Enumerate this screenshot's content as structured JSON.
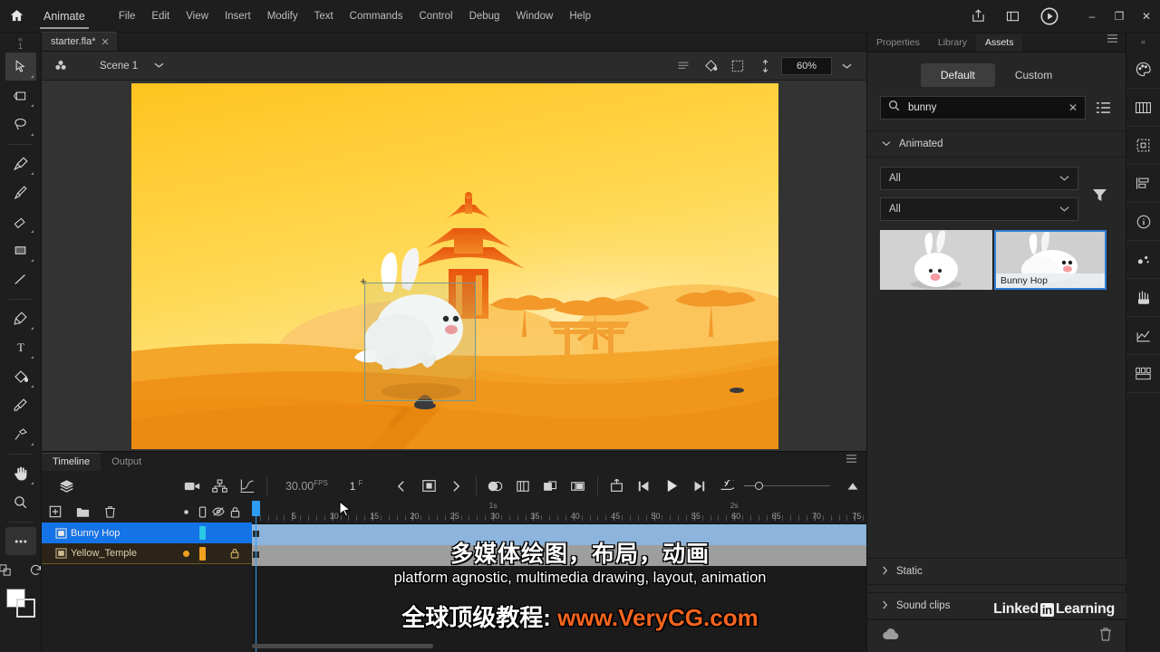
{
  "app": {
    "home_icon": "home-icon",
    "name": "Animate",
    "menus": [
      "File",
      "Edit",
      "View",
      "Insert",
      "Modify",
      "Text",
      "Commands",
      "Control",
      "Debug",
      "Window",
      "Help"
    ],
    "titlebar_buttons": [
      "share-icon",
      "workspace-icon",
      "test-movie-icon"
    ],
    "window_controls": {
      "minimize": "–",
      "maximize": "❐",
      "close": "✕"
    }
  },
  "document": {
    "tab_label": "starter.fla*",
    "tab_close": "✕"
  },
  "scenebar": {
    "symbol_icon": "scene-symbol-icon",
    "scene_name": "Scene 1",
    "caret": "chevron-down-icon",
    "right_icons": [
      "clip-content-icon",
      "fit-stage-icon",
      "rotate-icon"
    ],
    "zoom_value": "60%",
    "zoom_caret": "chevron-down-icon"
  },
  "tools": [
    {
      "name": "selection-tool",
      "glyph": "arrow",
      "active": true
    },
    {
      "name": "free-transform-tool",
      "glyph": "transform",
      "active": false
    },
    {
      "name": "lasso-tool",
      "glyph": "lasso",
      "active": false
    },
    {
      "name": "paint-brush-tool",
      "glyph": "paintbrush",
      "active": false
    },
    {
      "name": "brush-tool",
      "glyph": "brush",
      "active": false
    },
    {
      "name": "eraser-tool",
      "glyph": "eraser",
      "active": false
    },
    {
      "name": "rectangle-tool",
      "glyph": "rect",
      "active": false
    },
    {
      "name": "line-tool",
      "glyph": "line",
      "active": false
    },
    {
      "name": "pen-tool",
      "glyph": "pen",
      "active": false
    },
    {
      "name": "text-tool",
      "glyph": "text",
      "active": false
    },
    {
      "name": "paint-bucket-tool",
      "glyph": "bucket",
      "active": false
    },
    {
      "name": "eyedropper-tool",
      "glyph": "eyedropper",
      "active": false
    },
    {
      "name": "width-tool",
      "glyph": "pin",
      "active": false
    },
    {
      "name": "hand-tool",
      "glyph": "hand",
      "active": false
    },
    {
      "name": "zoom-tool",
      "glyph": "magnifier",
      "active": false
    },
    {
      "name": "edit-toolbar-button",
      "glyph": "ellipsis",
      "active": false
    },
    {
      "name": "swap-colors-icon",
      "glyph": "swap",
      "active": false
    }
  ],
  "right_rail": [
    "color-panel-icon",
    "swatches-panel-icon",
    "align-panel-icon",
    "transform-panel-icon",
    "info-panel-icon",
    "motion-editor-icon",
    "actions-panel-icon",
    "components-panel-icon",
    "frame-picker-icon"
  ],
  "stage": {
    "background_colors": {
      "sky_top": "#ffc62a",
      "sky_bottom": "#ffe9a6",
      "sand_light": "#f4a62a",
      "sand_mid": "#ef8f18",
      "sand_dark": "#e07d0c",
      "pagoda": "#e8650f",
      "hill": "#f6b748",
      "rock": "#3a3a3c"
    },
    "selection_border_color": "#7b9a8e",
    "registration_marker": "+"
  },
  "timeline": {
    "tabs": [
      {
        "label": "Timeline",
        "active": true
      },
      {
        "label": "Output",
        "active": false
      }
    ],
    "panel_menu_icon": "panel-menu-icon",
    "left_icons": [
      "layer-stack-icon"
    ],
    "mid_icons": [
      "camera-icon",
      "layer-parenting-icon",
      "motion-editor-graph-icon"
    ],
    "fps_value": "30.00",
    "fps_unit": "FPS",
    "current_frame": "1",
    "current_frame_unit": "F",
    "playback_icons": [
      "previous-keyframe-icon",
      "center-playhead-icon",
      "next-keyframe-icon",
      "onion-skin-icon",
      "onion-skin-outline-icon",
      "edit-multiple-frames-icon",
      "modify-onion-markers-icon",
      "loop-icon",
      "step-back-icon",
      "play-icon",
      "step-forward-icon",
      "reverse-icon"
    ],
    "zoom_slider_icon": "timeline-zoom-icon",
    "layer_header_icons": [
      "new-layer-icon",
      "new-folder-icon",
      "delete-layer-icon",
      "outline-dot-icon",
      "show-hide-col-icon",
      "eye-off-icon",
      "lock-icon"
    ],
    "layers": [
      {
        "name": "Bunny Hop",
        "icon": "symbol-layer-icon",
        "selected": true,
        "locked": false,
        "dot_color": "#2bc8e8"
      },
      {
        "name": "Yellow_Temple",
        "icon": "symbol-layer-icon",
        "selected": false,
        "locked": true,
        "dot_color": "#f0a020"
      }
    ],
    "ruler_labels": [
      "5",
      "10",
      "15",
      "20",
      "25",
      "30",
      "35",
      "40",
      "45",
      "50",
      "55",
      "60",
      "65",
      "70",
      "75"
    ],
    "second_labels": [
      "1s",
      "2s"
    ],
    "playhead_frame": 1,
    "playhead_color": "#2f9cf4"
  },
  "assets_panel": {
    "tabs": [
      {
        "label": "Properties",
        "active": false
      },
      {
        "label": "Library",
        "active": false
      },
      {
        "label": "Assets",
        "active": true
      }
    ],
    "panel_menu_icon": "panel-menu-icon",
    "segments": [
      {
        "label": "Default",
        "active": true
      },
      {
        "label": "Custom",
        "active": false
      }
    ],
    "search": {
      "icon": "search-icon",
      "value": "bunny",
      "placeholder": "Search",
      "clear_icon": "✕"
    },
    "view_toggle_icon": "list-view-icon",
    "sections": [
      {
        "label": "Animated",
        "expanded": true,
        "chevron": "chevron-down-icon"
      },
      {
        "label": "Static",
        "expanded": false,
        "chevron": "chevron-right-icon"
      },
      {
        "label": "Sound clips",
        "expanded": false,
        "chevron": "chevron-right-icon"
      }
    ],
    "filters": [
      {
        "name": "asset-type-filter",
        "value": "All",
        "caret": "chevron-down-icon"
      },
      {
        "name": "asset-category-filter",
        "value": "All",
        "caret": "chevron-down-icon"
      }
    ],
    "filter_icon": "funnel-icon",
    "assets": [
      {
        "name": "bunny-sit-asset",
        "label": "",
        "selected": false
      },
      {
        "name": "bunny-hop-asset",
        "label": "Bunny Hop",
        "selected": true
      }
    ],
    "footer_icons": [
      "cloud-sync-icon",
      "trash-icon"
    ],
    "watermark": {
      "text_1": "Linked",
      "badge": "in",
      "text_2": "Learning"
    }
  },
  "subtitles": {
    "line_cn": "多媒体绘图，布局，动画",
    "line_en": "platform agnostic, multimedia drawing, layout, animation",
    "line_url_prefix": "全球顶级教程: ",
    "line_url": "www.VeryCG.com",
    "url_color": "#f4641e"
  }
}
